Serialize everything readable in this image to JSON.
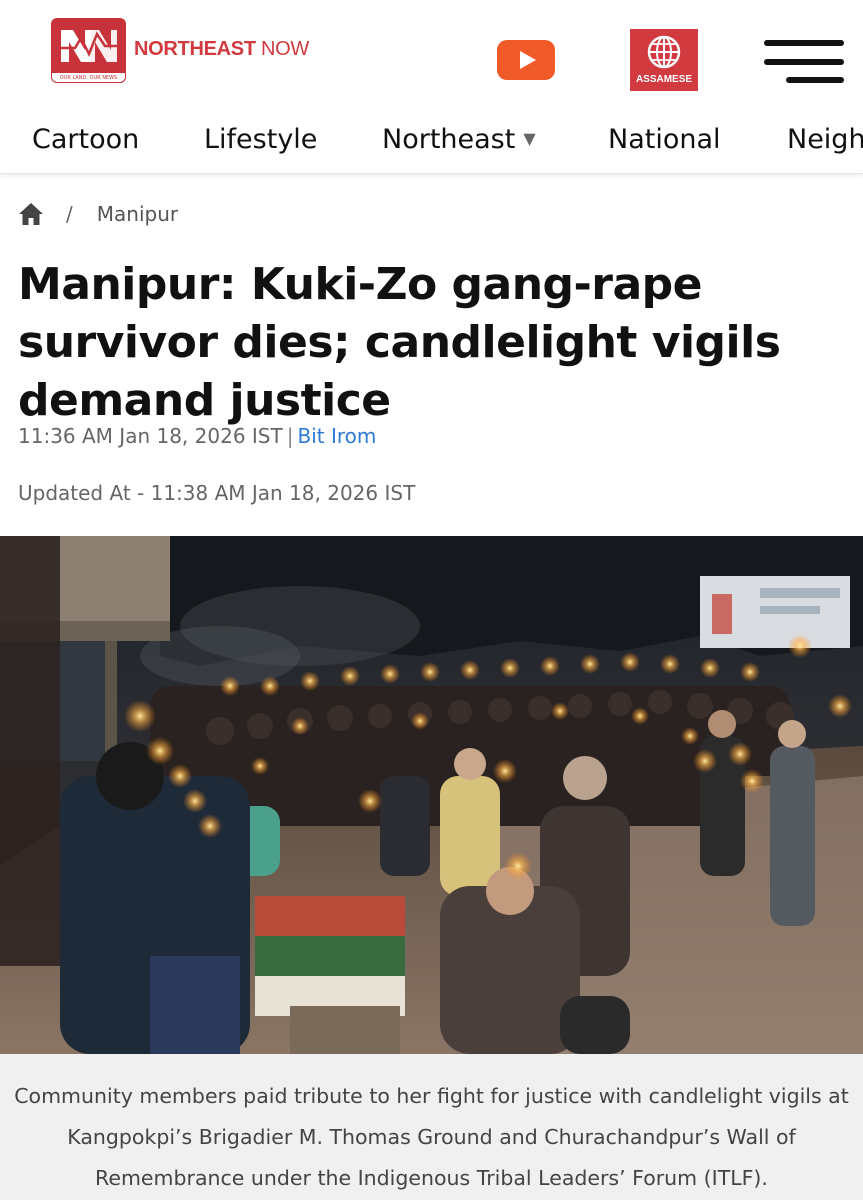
{
  "header": {
    "logo_text": "NORTHEAST NOW",
    "logo_tagline": "OUR LAND. OUR NEWS",
    "brand_bold": "NORTHEAST",
    "brand_light": " NOW",
    "youtube_icon": "youtube-play-icon",
    "assamese_label": "ASSAMESE",
    "menu_icon": "hamburger-menu-icon",
    "brand_color": "#d23a3f"
  },
  "nav": {
    "items": [
      {
        "label": "Cartoon"
      },
      {
        "label": "Lifestyle"
      },
      {
        "label": "Northeast",
        "has_dropdown": true
      },
      {
        "label": "National"
      },
      {
        "label": "Neigh"
      }
    ],
    "dropdown_caret": "▼"
  },
  "breadcrumb": {
    "home_icon": "home-icon",
    "separator": "/",
    "current": "Manipur"
  },
  "article": {
    "title": "Manipur: Kuki-Zo gang-rape survivor dies; candlelight vigils demand justice",
    "published": "11:36 AM Jan 18, 2026 IST",
    "byline_separator": "|",
    "author": "Bit Irom",
    "author_color": "#2d7ad6",
    "updated": "Updated At - 11:38 AM Jan 18, 2026 IST",
    "caption": "Community members paid tribute to her fight for justice with candlelight vigils at Kangpokpi’s Brigadier M. Thomas Ground and Churachandpur’s Wall of Remembrance under the Indigenous Tribal Leaders’ Forum (ITLF)."
  }
}
